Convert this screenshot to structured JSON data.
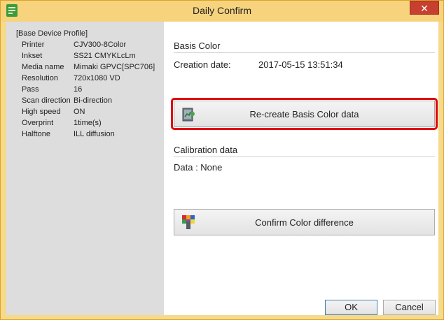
{
  "window": {
    "title": "Daily Confirm",
    "close_glyph": "✕",
    "icon": "app-logo-icon"
  },
  "profile": {
    "header": "[Base Device Profile]",
    "rows": [
      {
        "label": "Printer",
        "value": "CJV300-8Color"
      },
      {
        "label": "Inkset",
        "value": "SS21 CMYKLcLm"
      },
      {
        "label": "Media name",
        "value": "Mimaki GPVC[SPC706]"
      },
      {
        "label": "Resolution",
        "value": "720x1080 VD"
      },
      {
        "label": "Pass",
        "value": "16"
      },
      {
        "label": "Scan direction",
        "value": "Bi-direction"
      },
      {
        "label": "High speed",
        "value": "ON"
      },
      {
        "label": "Overprint",
        "value": "1time(s)"
      },
      {
        "label": "Halftone",
        "value": "ILL diffusion"
      }
    ]
  },
  "basis": {
    "title": "Basis Color",
    "creation_label": "Creation date:",
    "creation_value": "2017-05-15 13:51:34",
    "recreate_label": "Re-create Basis Color data",
    "recreate_icon": "chart-document-icon"
  },
  "calibration": {
    "title": "Calibration data",
    "data_text": "Data : None",
    "confirm_label": "Confirm Color difference",
    "confirm_icon": "color-patch-icon"
  },
  "footer": {
    "ok_label": "OK",
    "cancel_label": "Cancel"
  },
  "colors": {
    "title_bar": "#f7d37d",
    "close": "#c7402f",
    "highlight": "#e00000",
    "left_panel": "#dddddd"
  }
}
